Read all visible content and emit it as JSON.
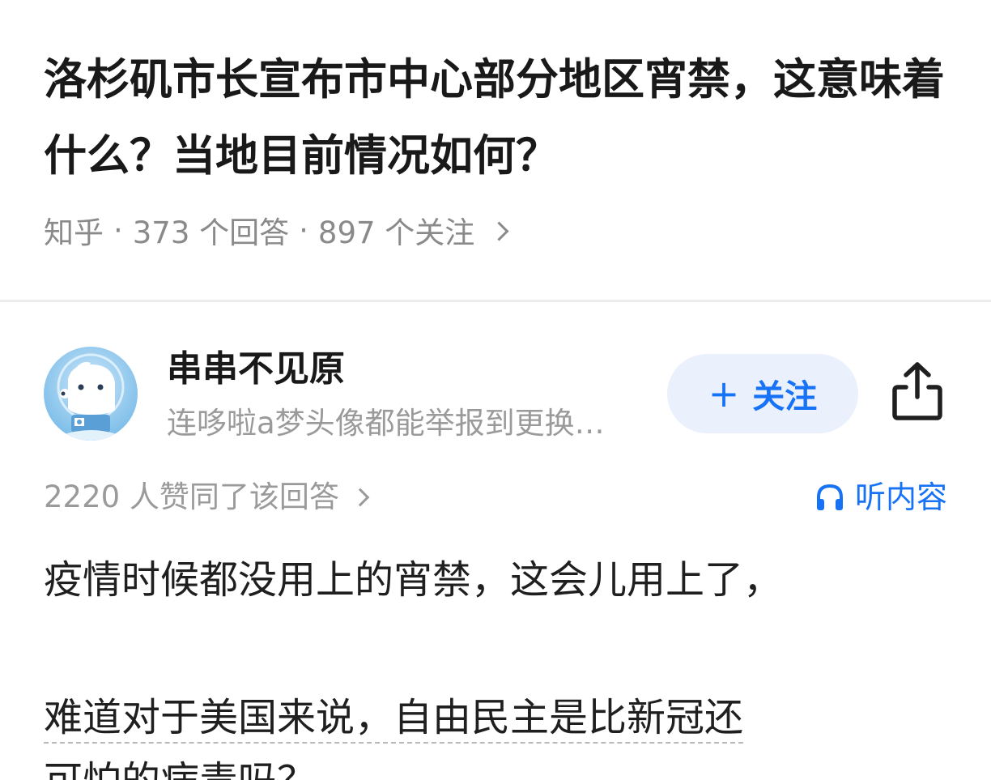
{
  "question": {
    "title": "洛杉矶市长宣布市中心部分地区宵禁，这意味着什么？当地目前情况如何？",
    "source": "知乎",
    "answers_count": "373 个回答",
    "followers_count": "897 个关注",
    "separator": "·"
  },
  "author": {
    "name": "串串不见原",
    "bio": "连哆啦a梦头像都能举报到更换…",
    "avatar_icon": "doraemon-avatar-icon"
  },
  "actions": {
    "follow_label": "关注",
    "follow_plus": "+",
    "share_icon": "share-icon",
    "listen_label": "听内容",
    "listen_icon": "headphones-icon"
  },
  "answer": {
    "votes_text": "2220 人赞同了该回答",
    "paragraphs": [
      "疫情时候都没用上的宵禁，这会儿用上了，",
      "难道对于美国来说，自由民主是比新冠还",
      "可怕的病毒吗？"
    ]
  },
  "colors": {
    "accent": "#1772f6",
    "follow_bg": "#eaf1fd",
    "meta_gray": "#8a8a8a",
    "title_black": "#191919"
  }
}
